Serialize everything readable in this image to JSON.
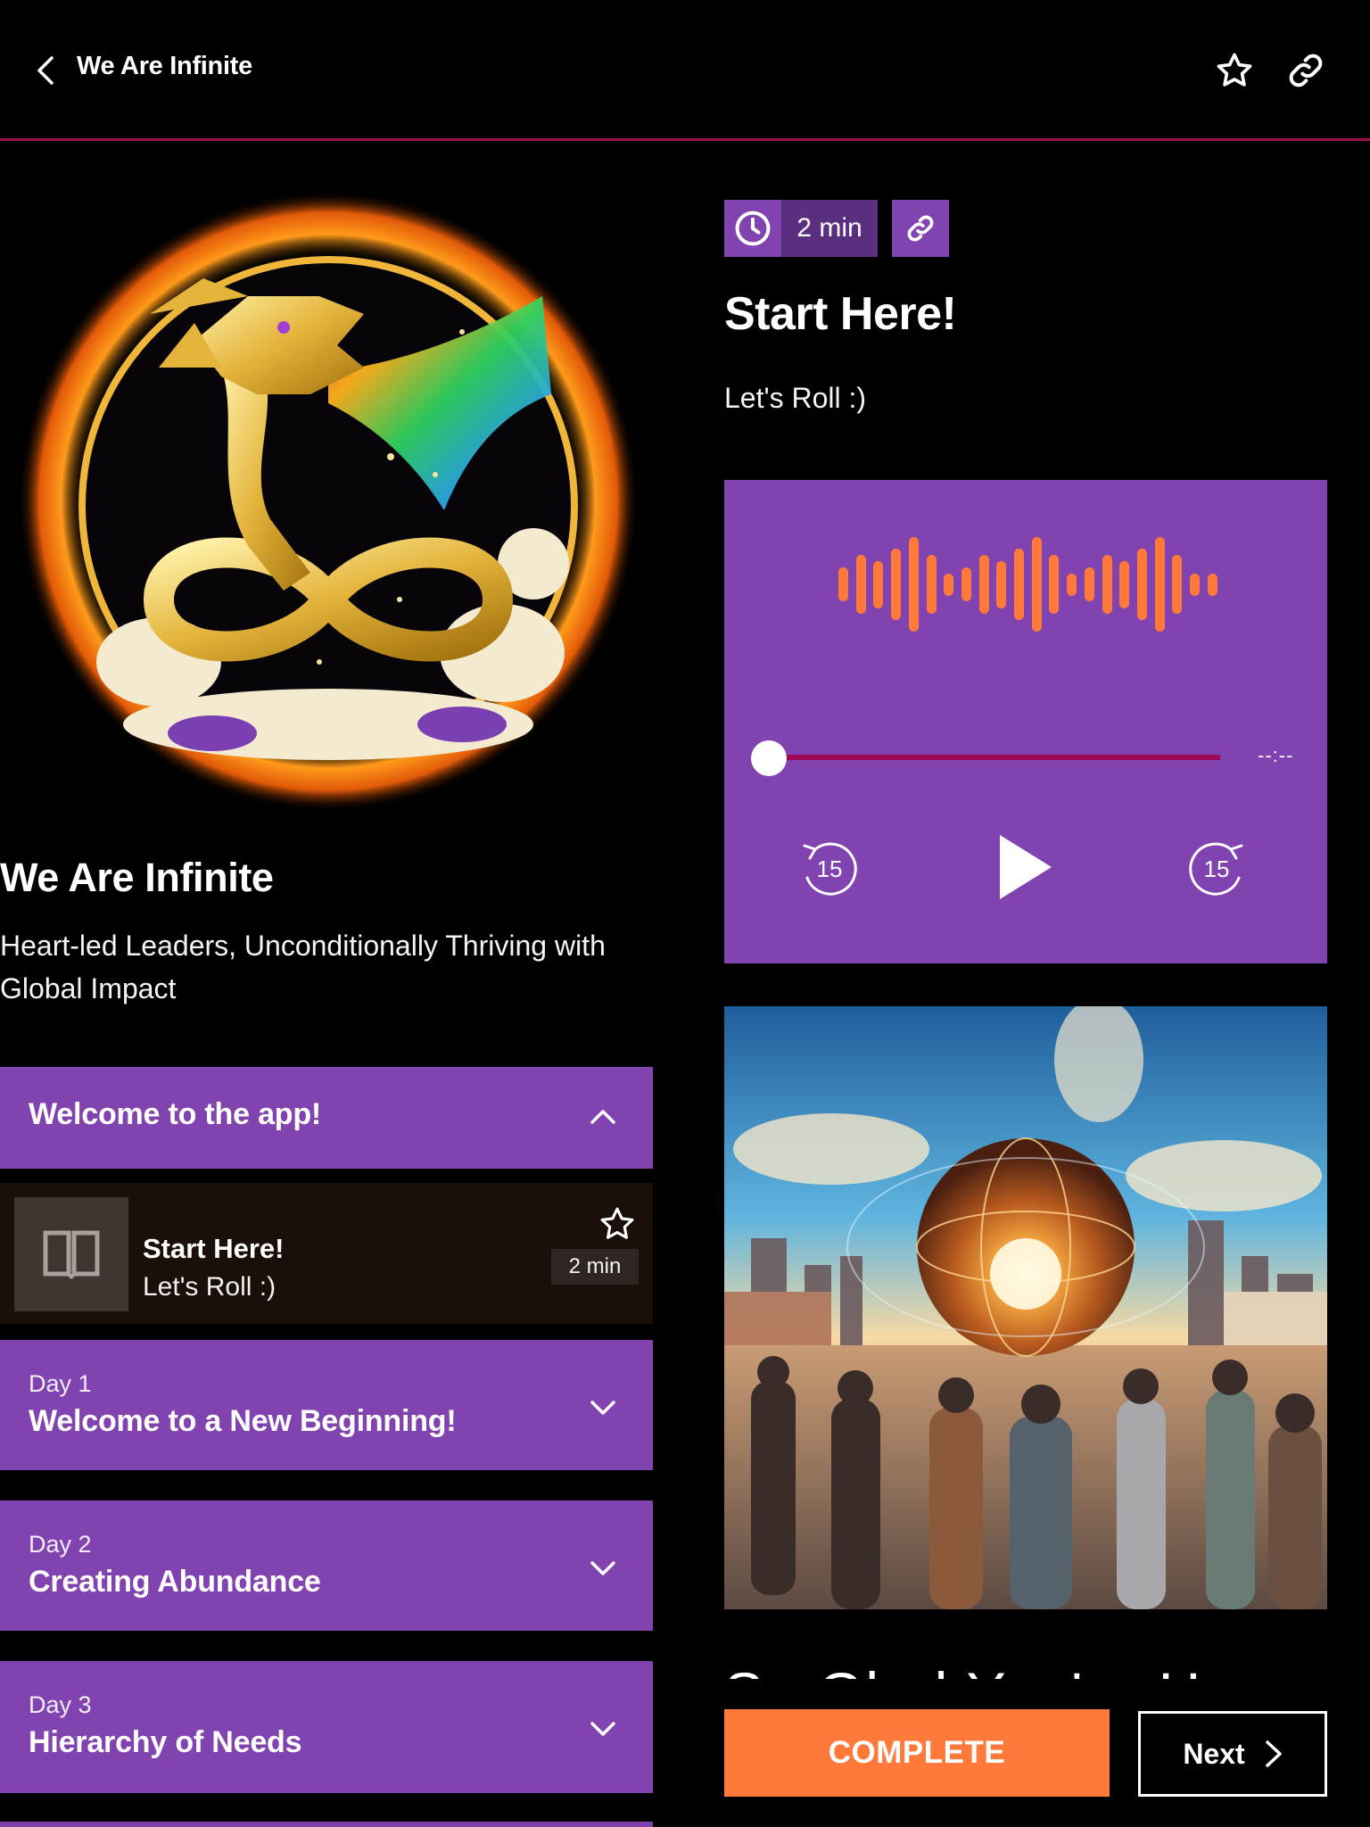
{
  "header": {
    "title": "We Are Infinite",
    "back_icon": "chevron-left-icon",
    "favorite_icon": "star-outline-icon",
    "share_icon": "link-icon"
  },
  "course": {
    "logo_alt": "Golden dragon forming an infinity symbol inside a fiery ring",
    "title": "We Are Infinite",
    "subtitle": "Heart-led Leaders, Unconditionally Thriving with Global Impact"
  },
  "sections": [
    {
      "day": "",
      "title": "Welcome to the app!",
      "expanded": true,
      "lessons": [
        {
          "title": "Start Here!",
          "subtitle": "Let's Roll :)",
          "duration": "2 min",
          "icon": "book-icon",
          "favorited": false
        }
      ]
    },
    {
      "day": "Day 1",
      "title": "Welcome to a New Beginning!",
      "expanded": false
    },
    {
      "day": "Day 2",
      "title": "Creating Abundance",
      "expanded": false
    },
    {
      "day": "Day 3",
      "title": "Hierarchy of Needs",
      "expanded": false
    }
  ],
  "lesson": {
    "duration": "2 min",
    "title": "Start Here!",
    "subtitle": "Let's Roll :)",
    "content_heading": "So Glad You're Here",
    "image_alt": "Crowd of people in a city plaza gazing at a glowing globe at sunrise"
  },
  "player": {
    "progress": 0,
    "time_remaining": "--:--",
    "skip_back_seconds": "15",
    "skip_forward_seconds": "15",
    "state": "paused"
  },
  "actions": {
    "complete_label": "COMPLETE",
    "next_label": "Next"
  },
  "colors": {
    "brand_purple": "#8043b0",
    "dark_purple": "#5a2f80",
    "accent_orange": "#ff7a3a",
    "progress_crimson": "#9e0a52",
    "header_divider": "#9a0f4c"
  }
}
